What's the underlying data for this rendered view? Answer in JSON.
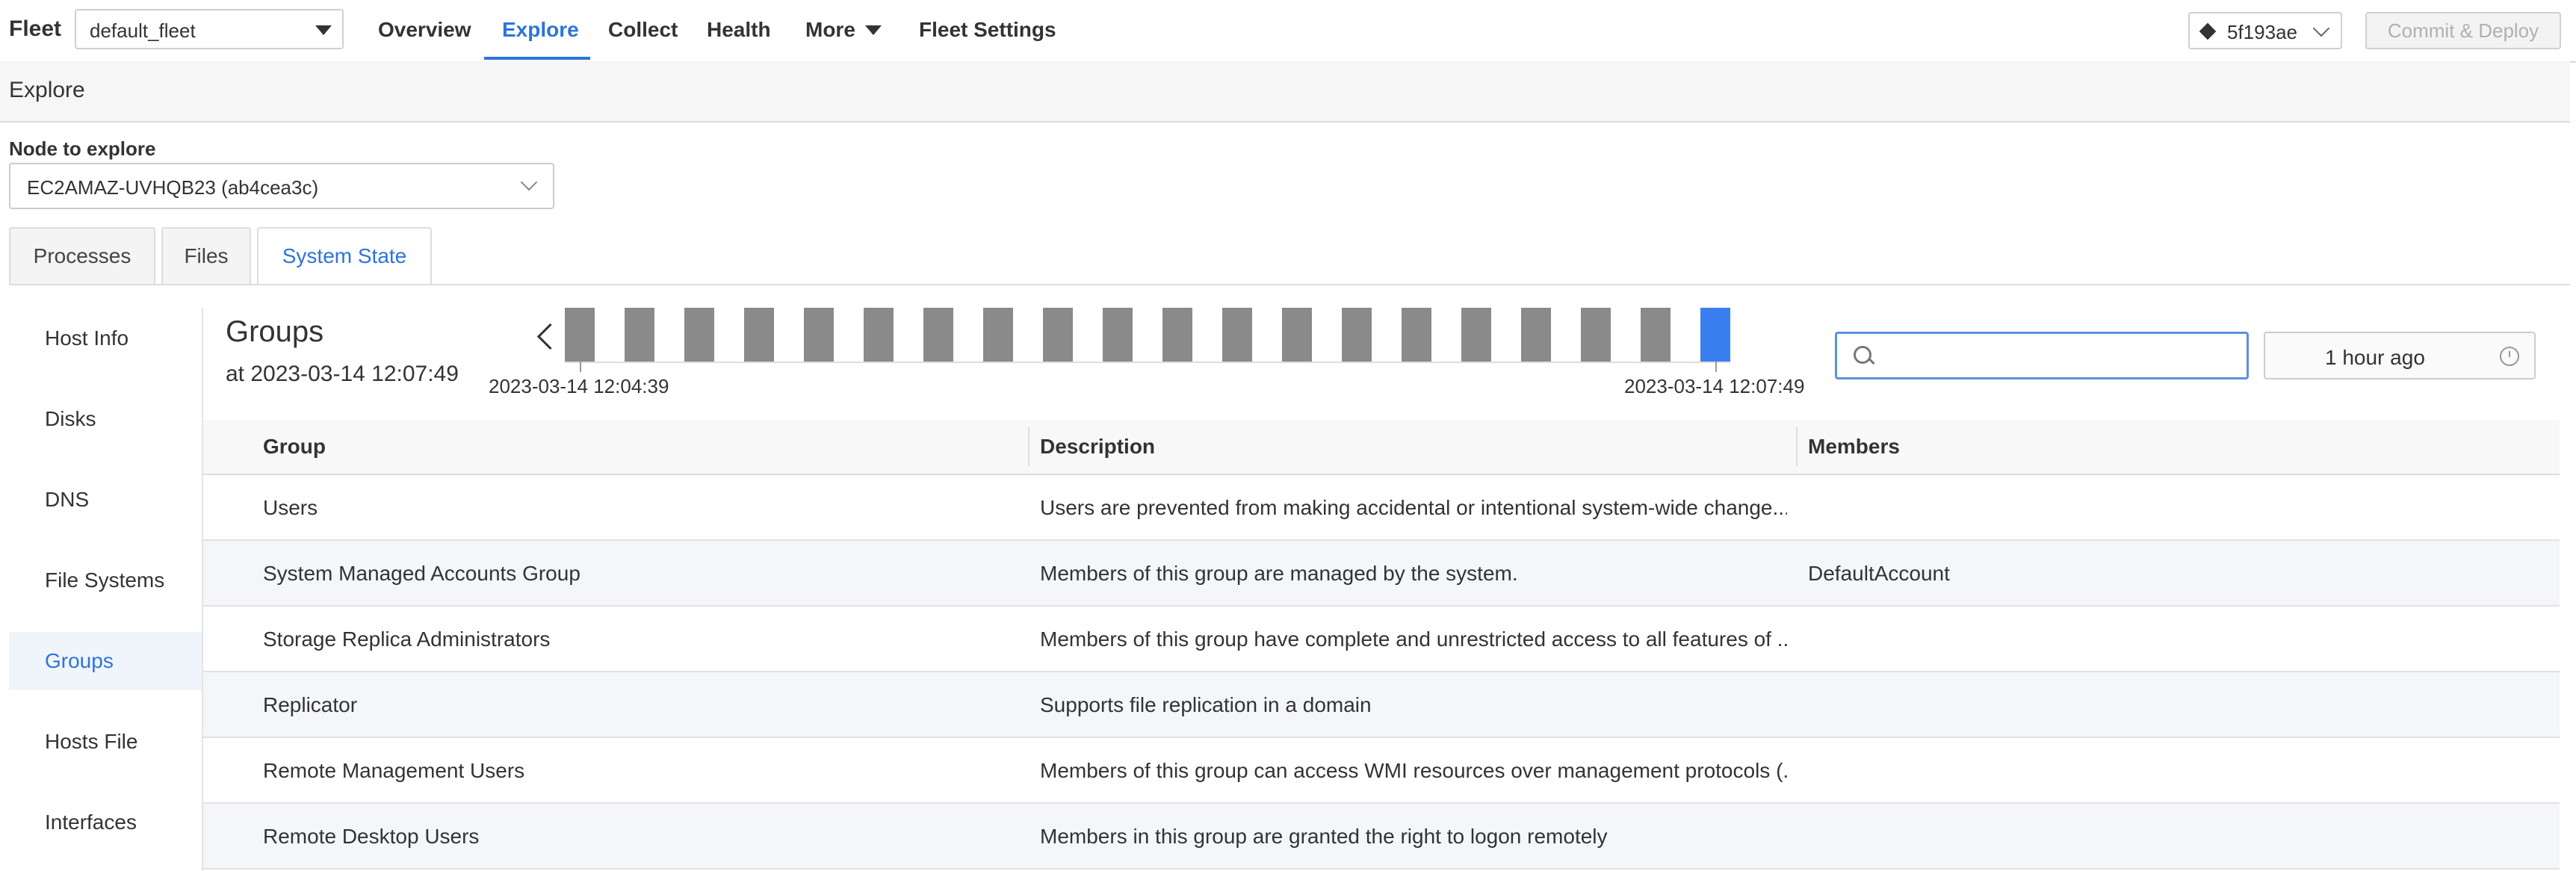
{
  "header": {
    "fleet_label": "Fleet",
    "fleet_select": "default_fleet",
    "nav": [
      "Overview",
      "Explore",
      "Collect",
      "Health",
      "More",
      "Fleet Settings"
    ],
    "active_nav": "Explore",
    "commit_hash": "5f193ae",
    "deploy_label": "Commit & Deploy"
  },
  "explore": {
    "title": "Explore",
    "node_label": "Node to explore",
    "node_value": "EC2AMAZ-UVHQB23 (ab4cea3c)"
  },
  "tabs": [
    "Processes",
    "Files",
    "System State"
  ],
  "active_tab": "System State",
  "sidebar": {
    "items": [
      "Host Info",
      "Disks",
      "DNS",
      "File Systems",
      "Groups",
      "Hosts File",
      "Interfaces"
    ],
    "active": "Groups"
  },
  "groups": {
    "title": "Groups",
    "subtitle": "at 2023-03-14 12:07:49",
    "timeline_start": "2023-03-14 12:04:39",
    "timeline_end": "2023-03-14 12:07:49",
    "timeline_snapshots": 20,
    "selected_snapshot": 20,
    "search_value": "",
    "time_range": "1 hour ago"
  },
  "table": {
    "columns": [
      "Group",
      "Description",
      "Members"
    ],
    "rows": [
      {
        "group": "Users",
        "description": "Users are prevented from making accidental or intentional system-wide change...",
        "members": ""
      },
      {
        "group": "System Managed Accounts Group",
        "description": "Members of this group are managed by the system.",
        "members": "DefaultAccount"
      },
      {
        "group": "Storage Replica Administrators",
        "description": "Members of this group have complete and unrestricted access to all features of ...",
        "members": ""
      },
      {
        "group": "Replicator",
        "description": "Supports file replication in a domain",
        "members": ""
      },
      {
        "group": "Remote Management Users",
        "description": "Members of this group can access WMI resources over management protocols (...",
        "members": ""
      },
      {
        "group": "Remote Desktop Users",
        "description": "Members in this group are granted the right to logon remotely",
        "members": ""
      }
    ]
  },
  "colors": {
    "accent": "#2d74da",
    "timeline_bar": "#8a8a8a",
    "timeline_selected": "#3a7fef"
  }
}
